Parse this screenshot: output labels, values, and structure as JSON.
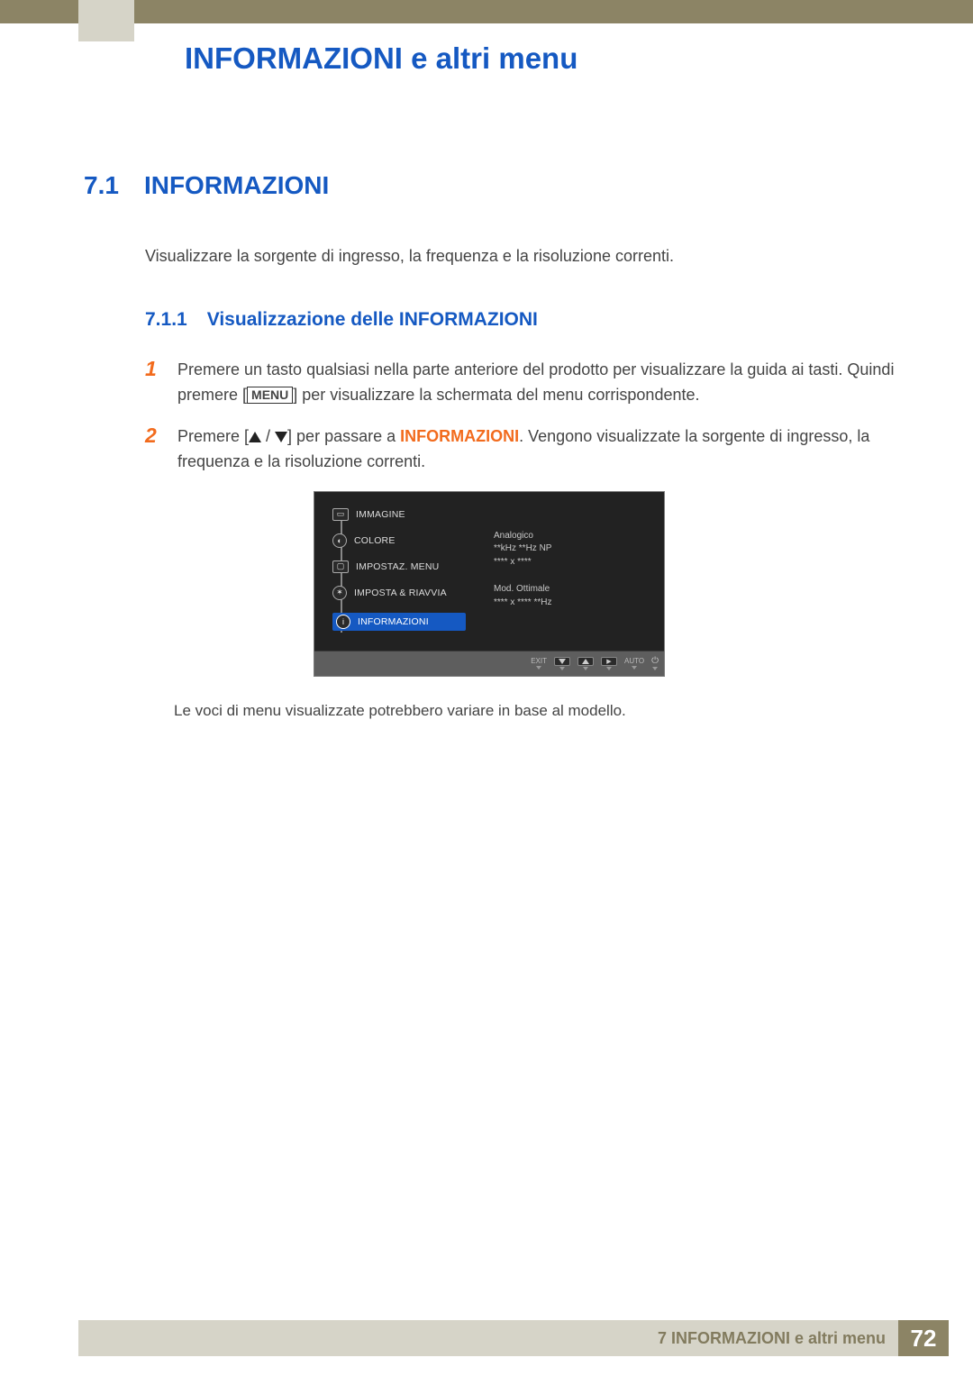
{
  "chapter_title": "INFORMAZIONI e altri menu",
  "section": {
    "num": "7.1",
    "title": "INFORMAZIONI"
  },
  "intro_para": "Visualizzare la sorgente di ingresso, la frequenza e la risoluzione correnti.",
  "subsection": {
    "num": "7.1.1",
    "title": "Visualizzazione delle INFORMAZIONI"
  },
  "steps": {
    "s1_text": "Premere un tasto qualsiasi nella parte anteriore del prodotto per visualizzare la guida ai tasti. Quindi premere [",
    "s1_after_menu": "] per visualizzare la schermata del menu corrispondente.",
    "s2_pre": "Premere [",
    "s2_mid": "] per passare a ",
    "s2_highlight": "INFORMAZIONI",
    "s2_post": ". Vengono visualizzate la sorgente di ingresso, la frequenza e la risoluzione correnti."
  },
  "menu_key": "MENU",
  "osd": {
    "items": {
      "immagine": "IMMAGINE",
      "colore": "COLORE",
      "impostaz_menu": "IMPOSTAZ. MENU",
      "imposta_riavvia": "IMPOSTA & RIAVVIA",
      "informazioni": "INFORMAZIONI"
    },
    "info_panel": {
      "line1": "Analogico",
      "line2": "**kHz **Hz NP",
      "line3": "**** x ****",
      "line4": "Mod. Ottimale",
      "line5": "**** x **** **Hz"
    },
    "footer": {
      "exit": "EXIT",
      "auto": "AUTO"
    }
  },
  "note": "Le voci di menu visualizzate potrebbero variare in base al modello.",
  "footer": {
    "text": "7 INFORMAZIONI e altri menu",
    "page": "72"
  }
}
